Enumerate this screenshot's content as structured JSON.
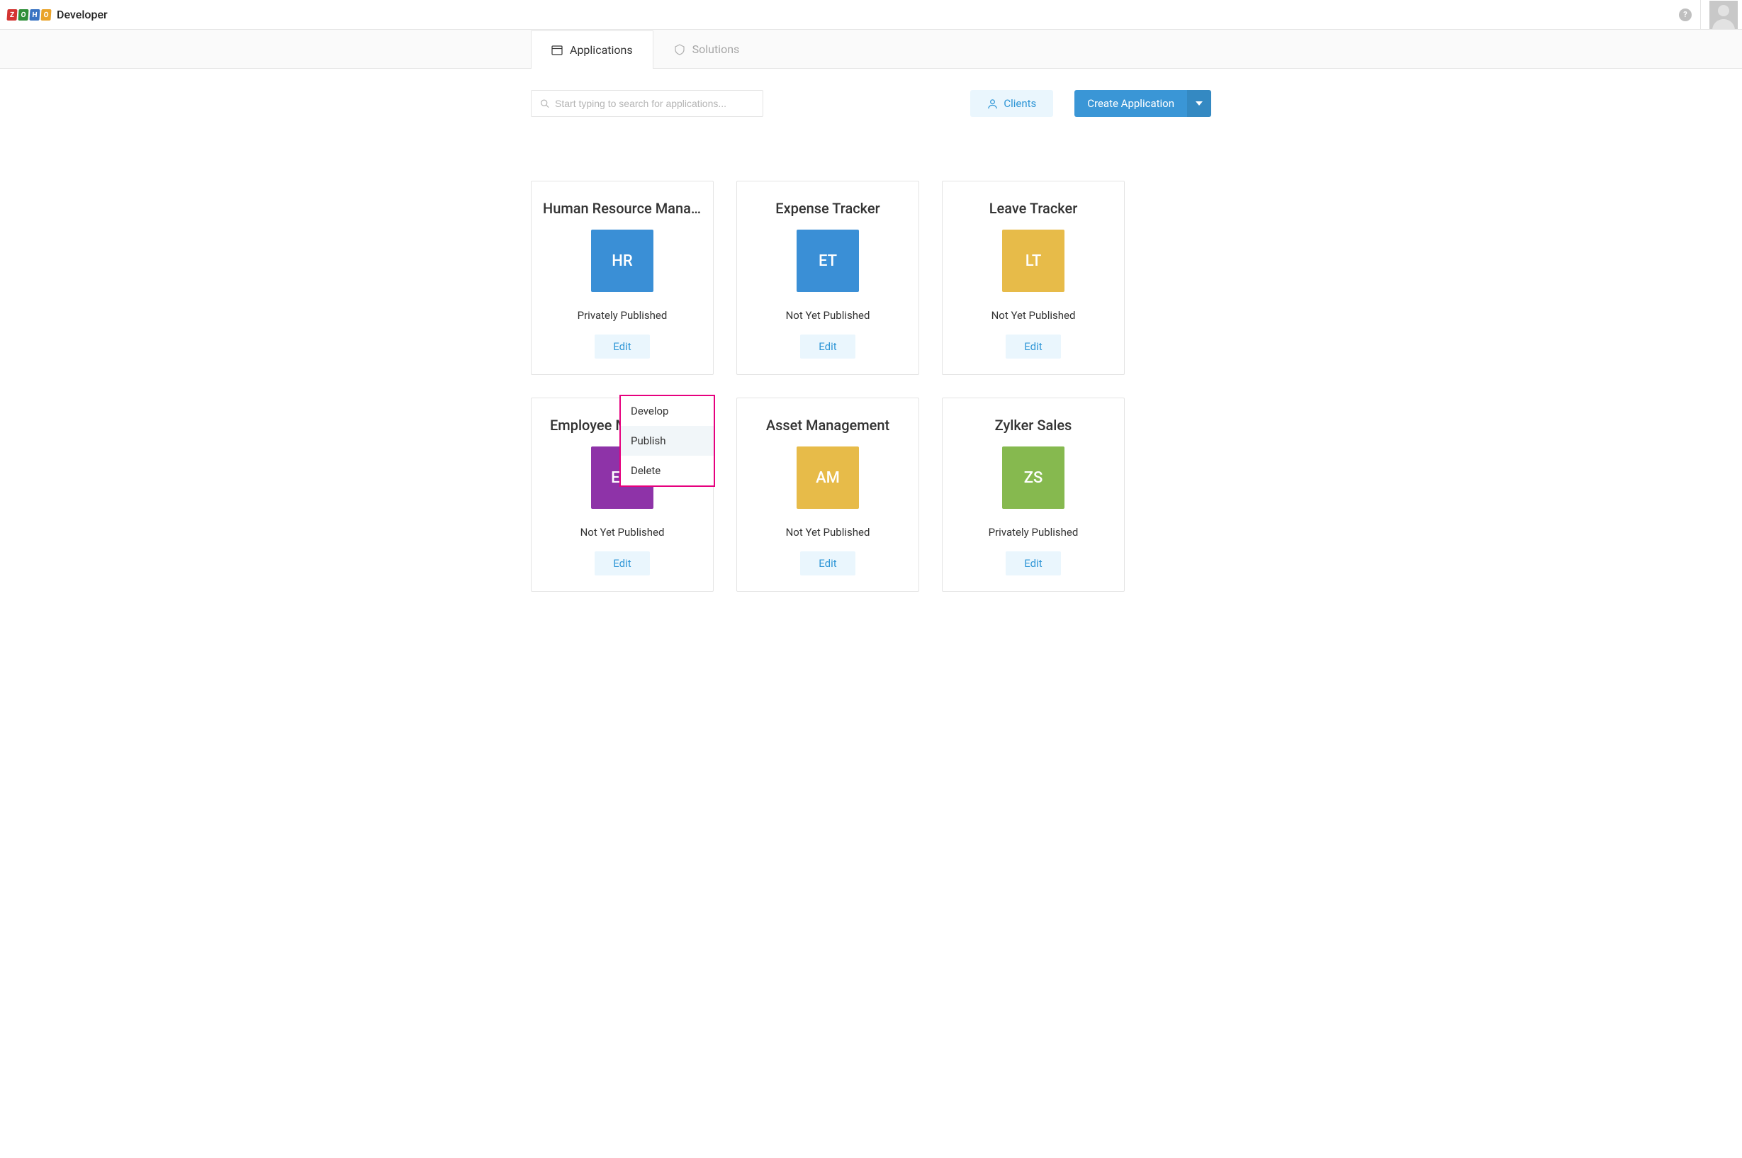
{
  "header": {
    "brand_title": "Developer",
    "logo_letters": [
      "Z",
      "O",
      "H",
      "O"
    ]
  },
  "tabs": [
    {
      "label": "Applications",
      "active": true
    },
    {
      "label": "Solutions",
      "active": false
    }
  ],
  "search": {
    "placeholder": "Start typing to search for applications..."
  },
  "buttons": {
    "clients": "Clients",
    "create_app": "Create Application"
  },
  "context_menu": {
    "items": [
      {
        "label": "Develop",
        "highlight": false
      },
      {
        "label": "Publish",
        "highlight": true
      },
      {
        "label": "Delete",
        "highlight": false
      }
    ]
  },
  "apps": [
    {
      "title": "Human Resource Management",
      "initials": "HR",
      "color": "#3a8fd6",
      "status": "Privately Published",
      "edit": "Edit"
    },
    {
      "title": "Expense Tracker",
      "initials": "ET",
      "color": "#3a8fd6",
      "status": "Not Yet Published",
      "edit": "Edit"
    },
    {
      "title": "Leave Tracker",
      "initials": "LT",
      "color": "#e7bb49",
      "status": "Not Yet Published",
      "edit": "Edit"
    },
    {
      "title": "Employee Management",
      "initials": "EM",
      "color": "#8e33a8",
      "status": "Not Yet Published",
      "edit": "Edit"
    },
    {
      "title": "Asset Management",
      "initials": "AM",
      "color": "#e7bb49",
      "status": "Not Yet Published",
      "edit": "Edit"
    },
    {
      "title": "Zylker Sales",
      "initials": "ZS",
      "color": "#86b94f",
      "status": "Privately Published",
      "edit": "Edit"
    }
  ]
}
